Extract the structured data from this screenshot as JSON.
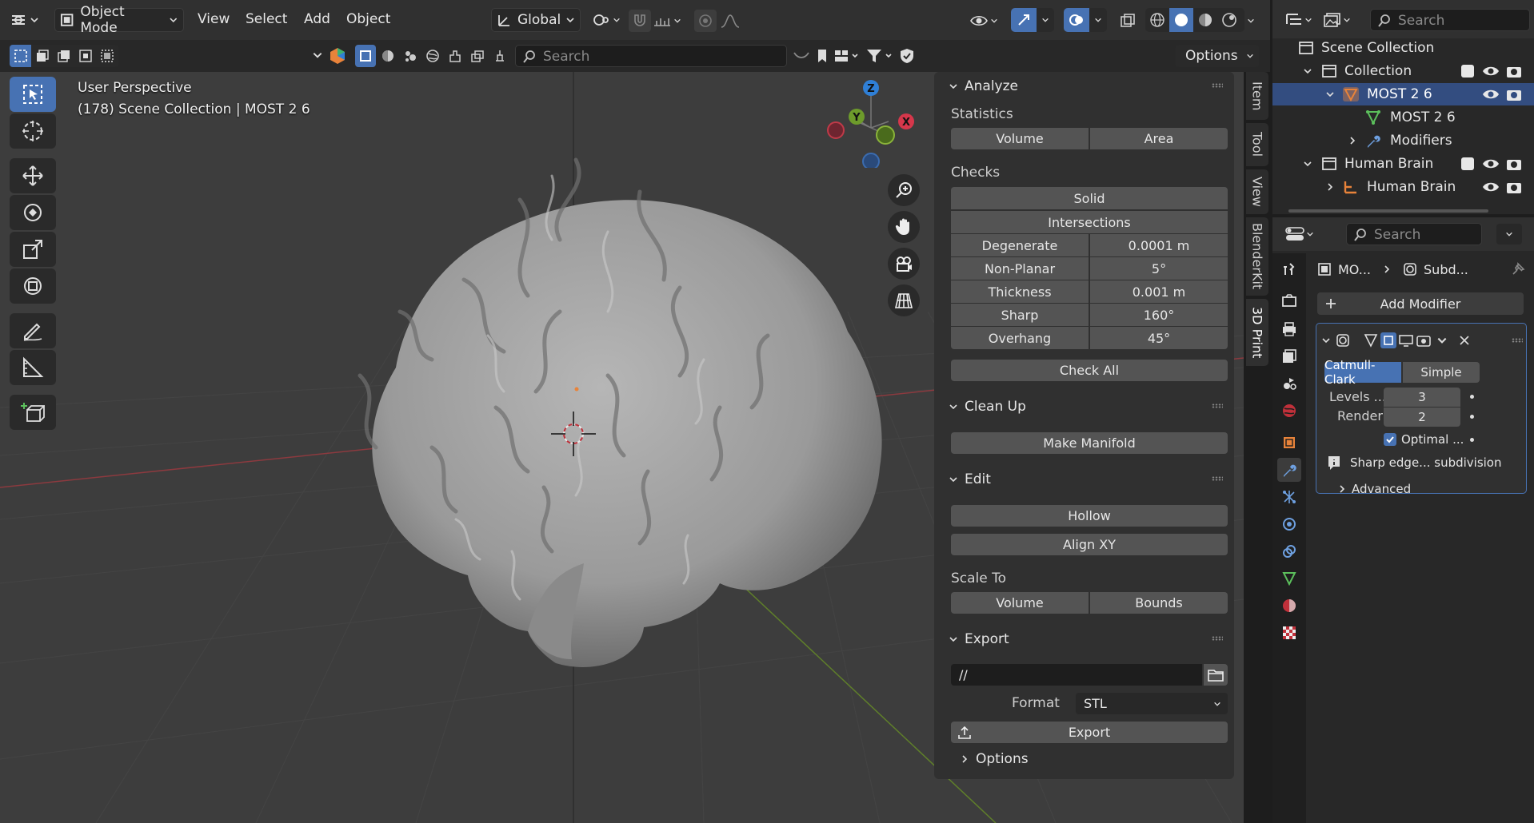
{
  "header": {
    "mode": "Object Mode",
    "menus": [
      "View",
      "Select",
      "Add",
      "Object"
    ],
    "orientation": "Global",
    "options_label": "Options",
    "search_placeholder": "Search"
  },
  "viewport": {
    "perspective": "User Perspective",
    "collection_info": "(178) Scene Collection | MOST 2 6",
    "gizmo_axes": {
      "z": "Z",
      "y": "Y",
      "x": "X"
    }
  },
  "npanel": {
    "analyze": {
      "title": "Analyze",
      "statistics_label": "Statistics",
      "stat_buttons": [
        "Volume",
        "Area"
      ],
      "checks_label": "Checks",
      "solid": "Solid",
      "intersections": "Intersections",
      "rows": [
        {
          "label": "Degenerate",
          "value": "0.0001 m"
        },
        {
          "label": "Non-Planar",
          "value": "5°"
        },
        {
          "label": "Thickness",
          "value": "0.001 m"
        },
        {
          "label": "Sharp",
          "value": "160°"
        },
        {
          "label": "Overhang",
          "value": "45°"
        }
      ],
      "check_all": "Check All"
    },
    "cleanup": {
      "title": "Clean Up",
      "make_manifold": "Make Manifold"
    },
    "edit": {
      "title": "Edit",
      "hollow": "Hollow",
      "align_xy": "Align XY",
      "scale_to_label": "Scale To",
      "scale_buttons": [
        "Volume",
        "Bounds"
      ]
    },
    "export": {
      "title": "Export",
      "path": "//",
      "format_label": "Format",
      "format_value": "STL",
      "export_button": "Export",
      "options": "Options"
    }
  },
  "vtabs": [
    "Item",
    "Tool",
    "View",
    "BlenderKit",
    "3D Print"
  ],
  "outliner": {
    "search_placeholder": "Search",
    "rows": [
      {
        "label": "Scene Collection"
      },
      {
        "label": "Collection"
      },
      {
        "label": "MOST 2 6"
      },
      {
        "label": "MOST 2 6"
      },
      {
        "label": "Modifiers"
      },
      {
        "label": "Human Brain"
      },
      {
        "label": "Human Brain"
      }
    ]
  },
  "properties": {
    "search_placeholder": "Search",
    "breadcrumb_object": "MO...",
    "breadcrumb_modifier": "Subd...",
    "add_modifier": "Add Modifier",
    "subdiv": {
      "tabs": [
        "Catmull-Clark",
        "Simple"
      ],
      "levels_label": "Levels ...",
      "levels_value": "3",
      "render_label": "Render",
      "render_value": "2",
      "optimal_label": "Optimal ...",
      "sharp_info": "Sharp edge... subdivision",
      "advanced": "Advanced"
    }
  },
  "colors": {
    "accent": "#4772b3",
    "x_axis": "#d6374b",
    "y_axis": "#6d9b2b",
    "z_axis": "#2f7fd6",
    "header_bg": "#303030",
    "panel_bg": "#282828"
  }
}
